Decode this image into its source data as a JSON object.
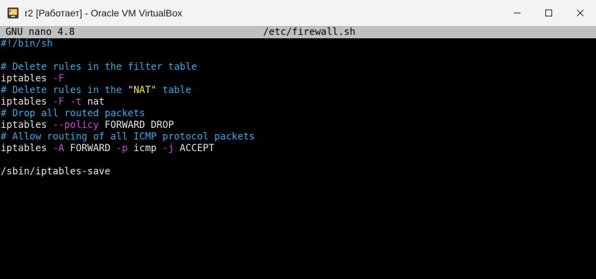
{
  "window": {
    "title": "r2 [Работает] - Oracle VM VirtualBox"
  },
  "nano": {
    "version": "GNU nano 4.8",
    "filename": "/etc/firewall.sh"
  },
  "colors": {
    "comment": "#39a9e6",
    "flag": "#c74ad8",
    "string": "#f2f046",
    "text": "#e6e6e6",
    "header_bg": "#c0c0c0",
    "background": "#000000"
  },
  "editor": {
    "lines": [
      [
        {
          "t": "#!/bin/sh",
          "c": "comment"
        }
      ],
      [],
      [
        {
          "t": "# Delete rules in the filter table",
          "c": "comment"
        }
      ],
      [
        {
          "t": "iptables ",
          "c": "plain"
        },
        {
          "t": "-F",
          "c": "flag"
        }
      ],
      [
        {
          "t": "# Delete rules in the ",
          "c": "comment"
        },
        {
          "t": "\"NAT\"",
          "c": "string"
        },
        {
          "t": " table",
          "c": "comment"
        }
      ],
      [
        {
          "t": "iptables ",
          "c": "plain"
        },
        {
          "t": "-F",
          "c": "flag"
        },
        {
          "t": " ",
          "c": "plain"
        },
        {
          "t": "-t",
          "c": "flag"
        },
        {
          "t": " nat",
          "c": "plain"
        }
      ],
      [
        {
          "t": "# Drop all routed packets",
          "c": "comment"
        }
      ],
      [
        {
          "t": "iptables ",
          "c": "plain"
        },
        {
          "t": "--policy",
          "c": "flag"
        },
        {
          "t": " FORWARD DROP",
          "c": "plain"
        }
      ],
      [
        {
          "t": "# Allow routing of all ICMP protocol packets",
          "c": "comment"
        }
      ],
      [
        {
          "t": "iptables ",
          "c": "plain"
        },
        {
          "t": "-A",
          "c": "flag"
        },
        {
          "t": " FORWARD ",
          "c": "plain"
        },
        {
          "t": "-p",
          "c": "flag"
        },
        {
          "t": " icmp ",
          "c": "plain"
        },
        {
          "t": "-j",
          "c": "flag"
        },
        {
          "t": " ACCEPT",
          "c": "plain"
        }
      ],
      [],
      [
        {
          "t": "/sbin/iptables-save",
          "c": "plain"
        }
      ]
    ]
  }
}
